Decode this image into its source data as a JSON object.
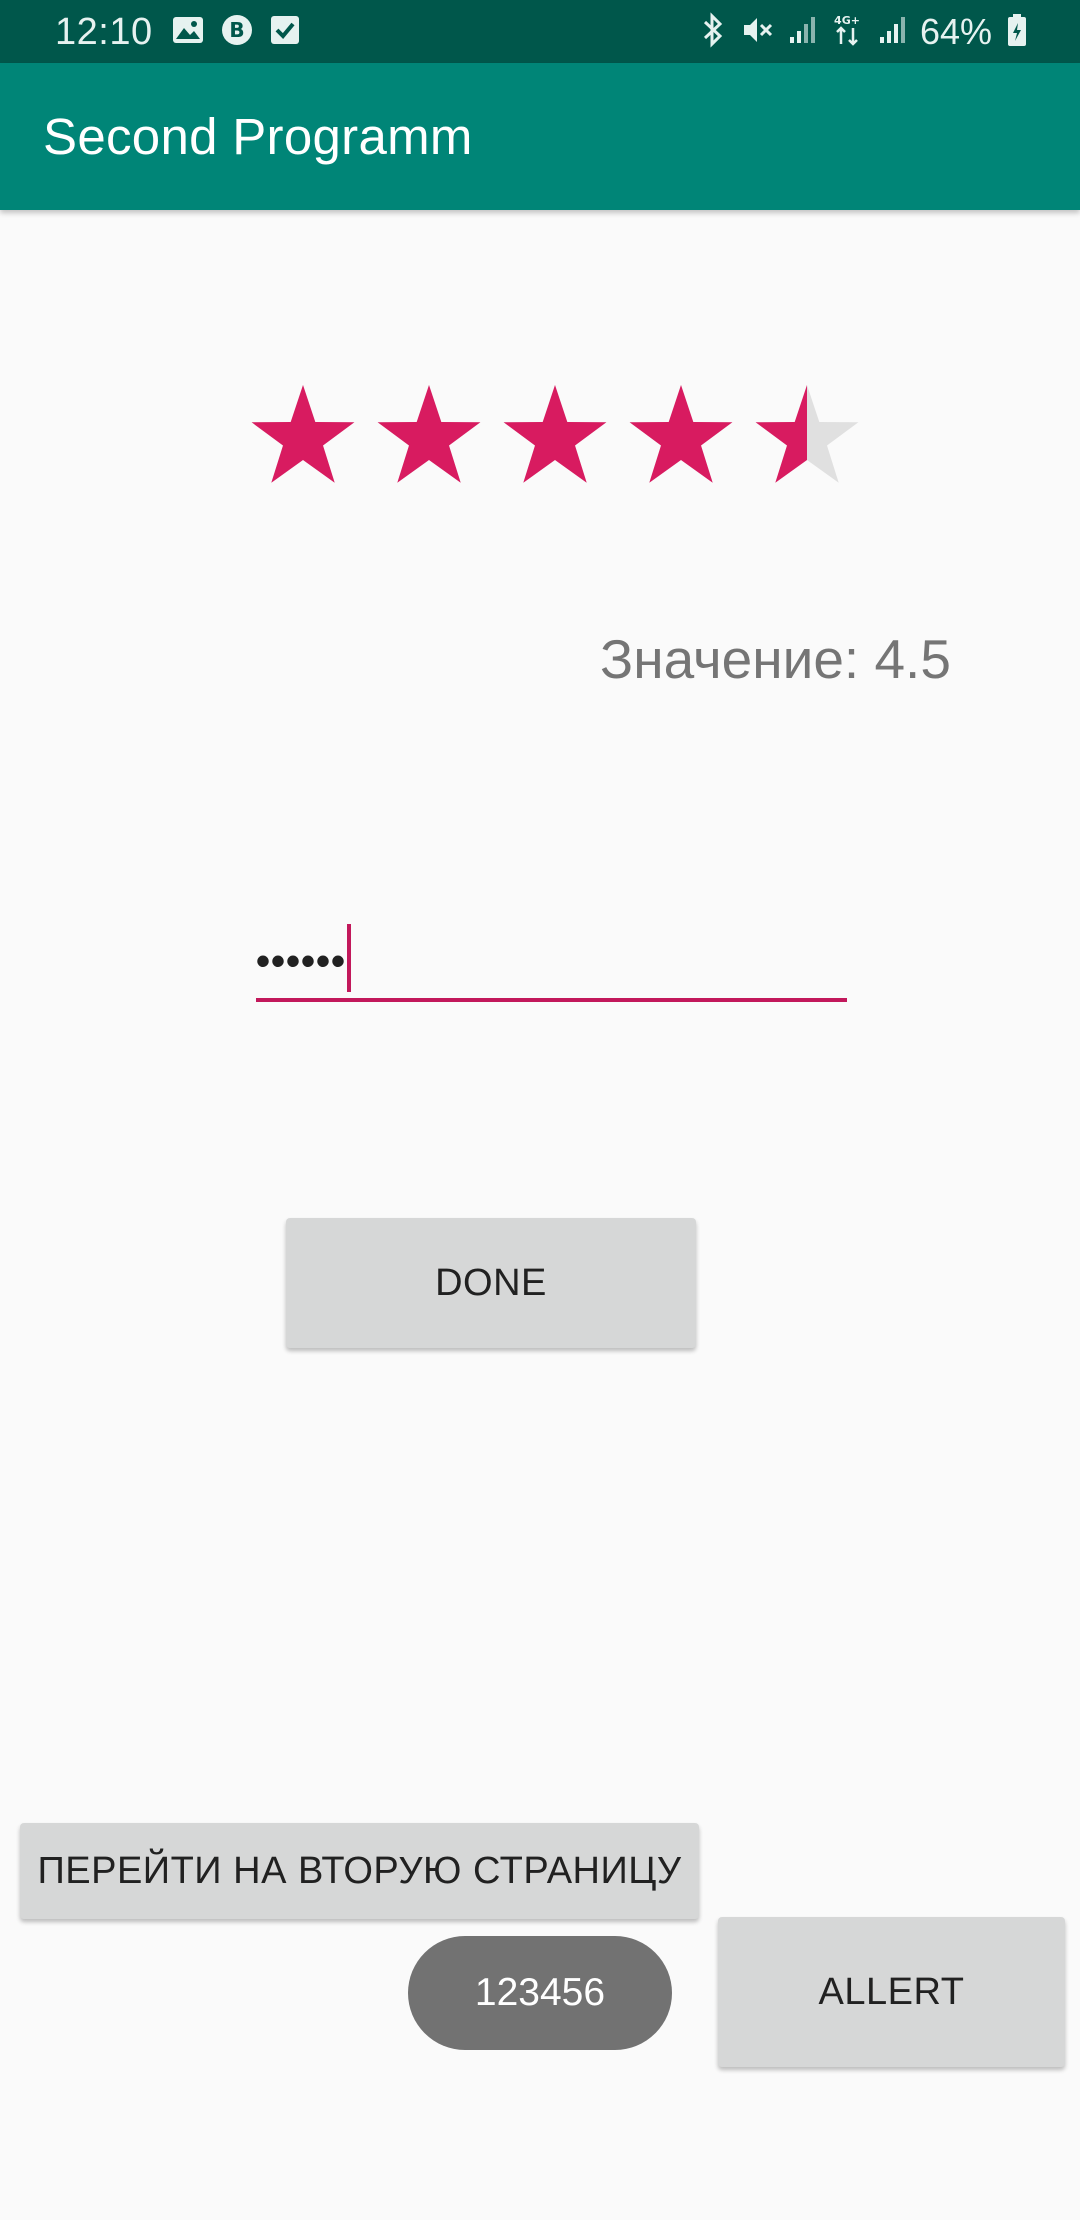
{
  "status_bar": {
    "time": "12:10",
    "battery": "64%",
    "left_icons": [
      "image-icon",
      "vk-icon",
      "checkbox-icon"
    ],
    "right_icons": [
      "bluetooth-icon",
      "mute-icon",
      "signal-icon",
      "4g-signal-icon",
      "signal-icon",
      "battery-icon"
    ]
  },
  "app_bar": {
    "title": "Second Programm"
  },
  "rating": {
    "value": 4.5,
    "max": 5,
    "filled_color": "#d81b60",
    "empty_color": "#e0e0e0"
  },
  "value_label": "Значение: 4.5",
  "password_field": {
    "value": "••••••"
  },
  "buttons": {
    "done_label": "DONE",
    "goto_label": "ПЕРЕЙТИ НА ВТОРУЮ СТРАНИЦУ",
    "allert_label": "ALLERT"
  },
  "toast": {
    "text": "123456"
  },
  "colors": {
    "status_bar": "#00574b",
    "app_bar": "#008577",
    "accent": "#c2185b"
  }
}
